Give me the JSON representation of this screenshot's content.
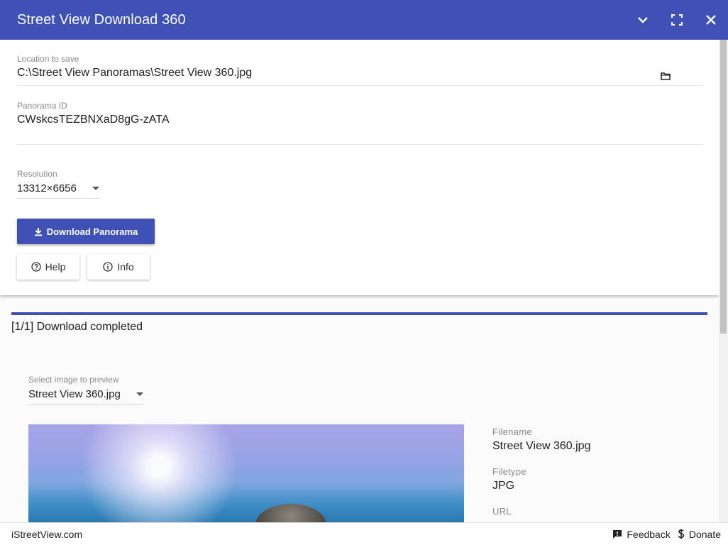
{
  "app": {
    "title": "Street View Download 360"
  },
  "icons": {
    "collapse": "chevron-down-icon",
    "fullscreen": "fullscreen-icon",
    "close": "close-icon",
    "folder": "folder-icon",
    "download": "download-icon",
    "help": "help-circle-icon",
    "info": "info-circle-icon",
    "feedback": "feedback-icon",
    "donate": "dollar-icon"
  },
  "colors": {
    "primary": "#3f51b5"
  },
  "form": {
    "location_label": "Location to save",
    "location_value": "C:\\Street View Panoramas\\Street View 360.jpg",
    "panorama_id_label": "Panorama ID",
    "panorama_id_value": "CWskcsTEZBNXaD8gG-zATA",
    "resolution_label": "Resolution",
    "resolution_value": "13312×6656"
  },
  "buttons": {
    "download": "Download Panorama",
    "help": "Help",
    "info": "Info"
  },
  "download": {
    "status": "[1/1] Download completed",
    "progress": 1.0
  },
  "preview": {
    "select_label": "Select image to preview",
    "selected": "Street View 360.jpg",
    "filename_label": "Filename",
    "filename": "Street View 360.jpg",
    "filetype_label": "Filetype",
    "filetype": "JPG",
    "url_label": "URL"
  },
  "footer": {
    "site": "iStreetView.com",
    "feedback": "Feedback",
    "donate": "Donate"
  }
}
